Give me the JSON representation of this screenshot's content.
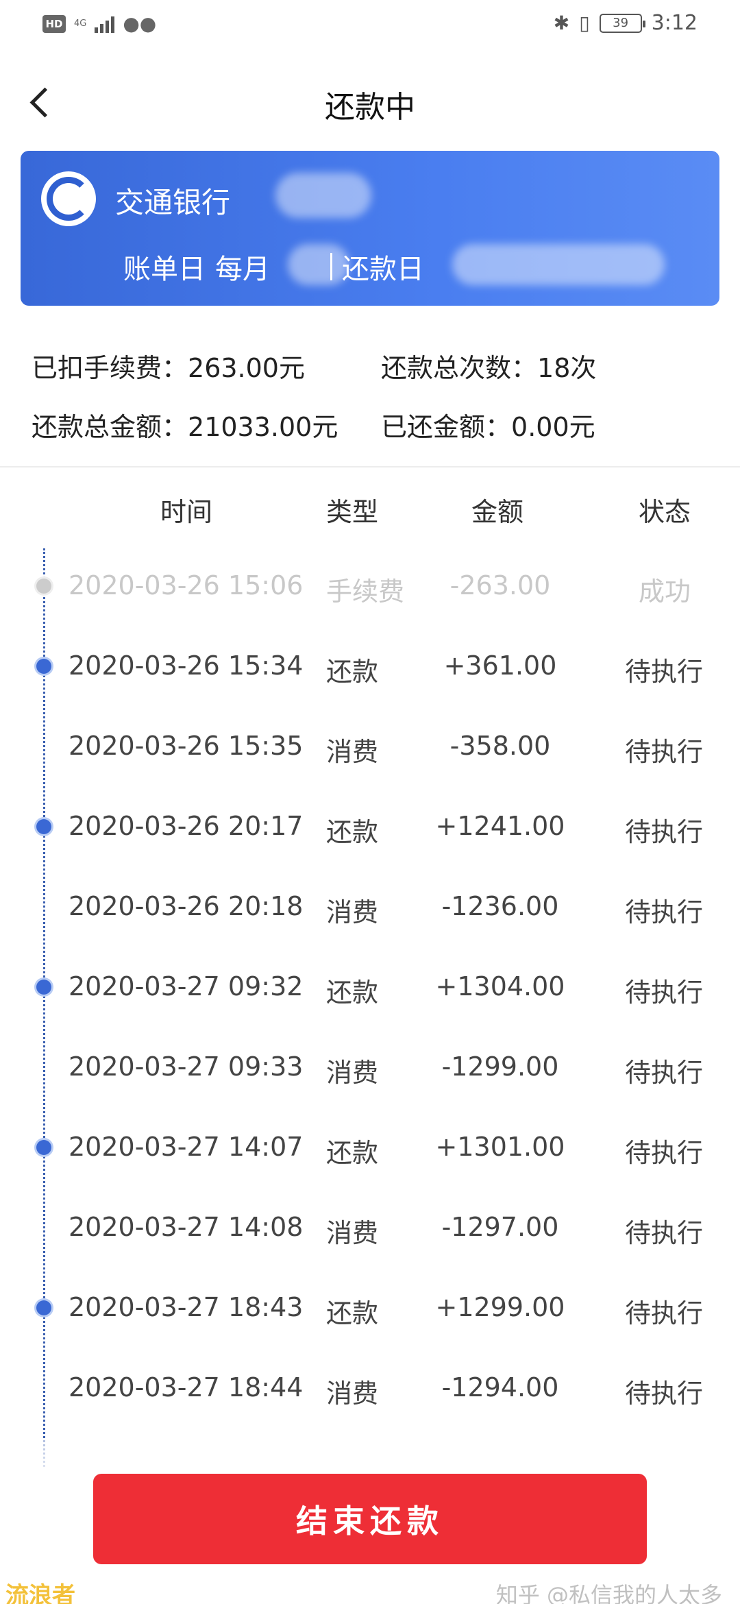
{
  "status_bar": {
    "hd": "HD",
    "network": "4G",
    "battery": "39",
    "time": "3:12"
  },
  "header": {
    "title": "还款中"
  },
  "bank_card": {
    "bank_name": "交通银行",
    "bill_day_label": "账单日",
    "bill_day_prefix": "每月",
    "repay_day_label": "还款日"
  },
  "summary": {
    "fee_label": "已扣手续费：",
    "fee_value": "263.00元",
    "count_label": "还款总次数：",
    "count_value": "18次",
    "total_label": "还款总金额：",
    "total_value": "21033.00元",
    "repaid_label": "已还金额：",
    "repaid_value": "0.00元"
  },
  "table": {
    "headers": [
      "时间",
      "类型",
      "金额",
      "状态"
    ],
    "rows": [
      {
        "time": "2020-03-26 15:06",
        "type": "手续费",
        "amount": "-263.00",
        "status": "成功"
      },
      {
        "time": "2020-03-26 15:34",
        "type": "还款",
        "amount": "+361.00",
        "status": "待执行"
      },
      {
        "time": "2020-03-26 15:35",
        "type": "消费",
        "amount": "-358.00",
        "status": "待执行"
      },
      {
        "time": "2020-03-26 20:17",
        "type": "还款",
        "amount": "+1241.00",
        "status": "待执行"
      },
      {
        "time": "2020-03-26 20:18",
        "type": "消费",
        "amount": "-1236.00",
        "status": "待执行"
      },
      {
        "time": "2020-03-27 09:32",
        "type": "还款",
        "amount": "+1304.00",
        "status": "待执行"
      },
      {
        "time": "2020-03-27 09:33",
        "type": "消费",
        "amount": "-1299.00",
        "status": "待执行"
      },
      {
        "time": "2020-03-27 14:07",
        "type": "还款",
        "amount": "+1301.00",
        "status": "待执行"
      },
      {
        "time": "2020-03-27 14:08",
        "type": "消费",
        "amount": "-1297.00",
        "status": "待执行"
      },
      {
        "time": "2020-03-27 18:43",
        "type": "还款",
        "amount": "+1299.00",
        "status": "待执行"
      },
      {
        "time": "2020-03-27 18:44",
        "type": "消费",
        "amount": "-1294.00",
        "status": "待执行"
      }
    ]
  },
  "actions": {
    "end_label": "结束还款"
  },
  "watermarks": {
    "right": "知乎 @私信我的人太多",
    "left": "流浪者"
  }
}
